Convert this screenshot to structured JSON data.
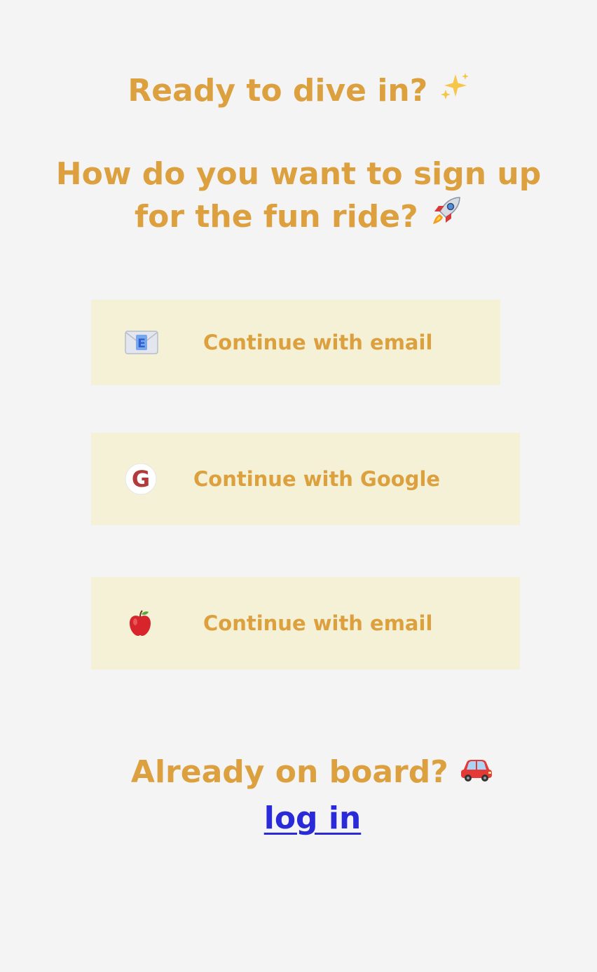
{
  "heading": {
    "greeting": "Ready to dive in?",
    "greeting_icon": "sparkles-icon",
    "question": "How do you want to sign up for the fun ride?",
    "question_icon": "rocket-icon"
  },
  "options": [
    {
      "label": "Continue with email",
      "icon": "envelope-icon"
    },
    {
      "label": "Continue with Google",
      "icon": "google-icon"
    },
    {
      "label": "Continue with email",
      "icon": "apple-icon"
    }
  ],
  "footer": {
    "prompt": "Already on board?",
    "prompt_icon": "car-icon",
    "login_label": "log in"
  },
  "colors": {
    "background": "#f4f4f4",
    "accent": "#dca03f",
    "button_bg": "#f4f1d6",
    "link": "#2a2ad8"
  }
}
